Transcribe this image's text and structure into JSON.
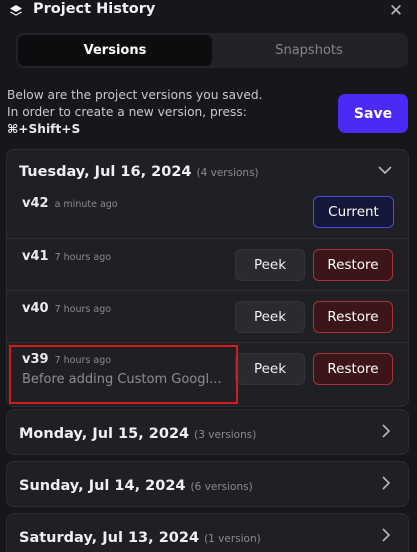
{
  "panel": {
    "title": "Project History"
  },
  "tabs": [
    {
      "label": "Versions",
      "active": true
    },
    {
      "label": "Snapshots",
      "active": false
    }
  ],
  "intro": {
    "line1": "Below are the project versions you saved.",
    "line2": "In order to create a new version, press:",
    "shortcut": "⌘+Shift+S"
  },
  "save_label": "Save",
  "days": [
    {
      "date": "Tuesday, Jul 16, 2024",
      "count": "(4 versions)",
      "expanded": true,
      "versions": [
        {
          "num": "v42",
          "time": "a minute ago",
          "current_label": "Current"
        },
        {
          "num": "v41",
          "time": "7 hours ago",
          "peek_label": "Peek",
          "restore_label": "Restore"
        },
        {
          "num": "v40",
          "time": "7 hours ago",
          "peek_label": "Peek",
          "restore_label": "Restore"
        },
        {
          "num": "v39",
          "time": "7 hours ago",
          "description": "Before adding Custom Googl...",
          "peek_label": "Peek",
          "restore_label": "Restore"
        }
      ]
    },
    {
      "date": "Monday, Jul 15, 2024",
      "count": "(3 versions)",
      "expanded": false
    },
    {
      "date": "Sunday, Jul 14, 2024",
      "count": "(6 versions)",
      "expanded": false
    },
    {
      "date": "Saturday, Jul 13, 2024",
      "count": "(1 version)",
      "expanded": false
    }
  ],
  "colors": {
    "accent": "#4a2bf5",
    "restore_border": "#a8333b",
    "current_border": "#4a4ed8",
    "highlight": "#d51b1b"
  }
}
